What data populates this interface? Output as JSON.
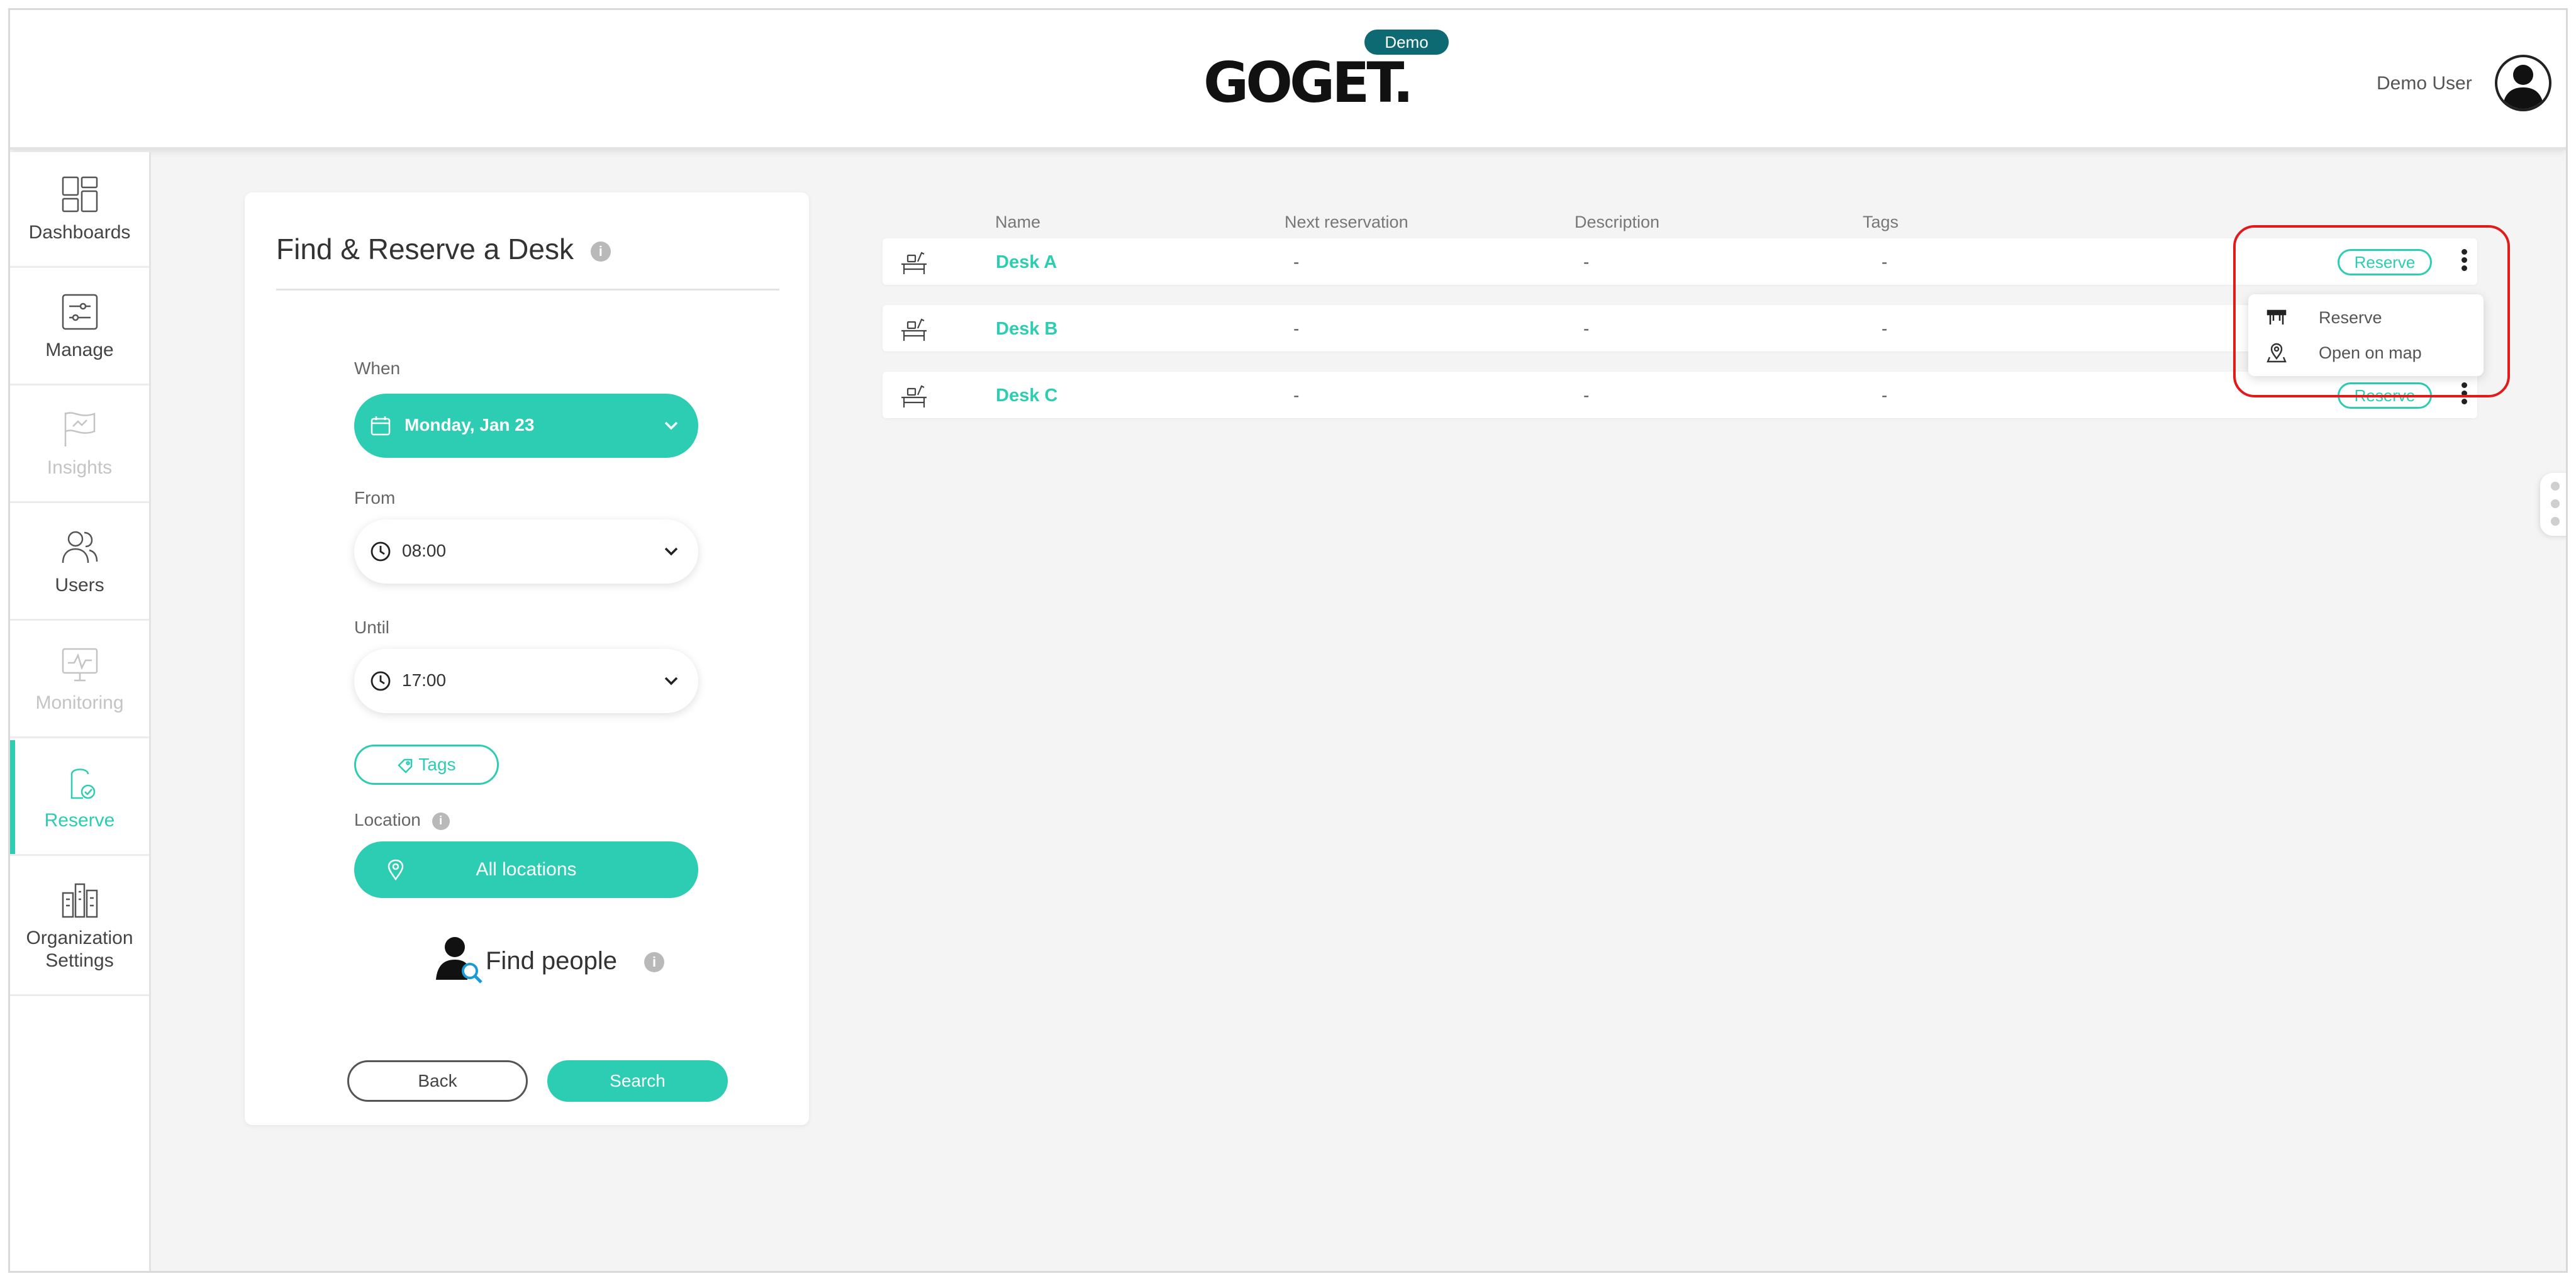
{
  "header": {
    "logo_text": "GOGET.",
    "badge": "Demo",
    "user_name": "Demo User"
  },
  "sidebar": {
    "items": [
      {
        "label": "Dashboards",
        "icon": "dashboard-icon",
        "state": "normal"
      },
      {
        "label": "Manage",
        "icon": "sliders-icon",
        "state": "normal"
      },
      {
        "label": "Insights",
        "icon": "flag-icon",
        "state": "disabled"
      },
      {
        "label": "Users",
        "icon": "users-icon",
        "state": "normal"
      },
      {
        "label": "Monitoring",
        "icon": "monitor-icon",
        "state": "disabled"
      },
      {
        "label": "Reserve",
        "icon": "lock-check-icon",
        "state": "active"
      },
      {
        "label": "Organization Settings",
        "icon": "buildings-icon",
        "state": "normal"
      }
    ]
  },
  "find_panel": {
    "title": "Find & Reserve a Desk",
    "info": "i",
    "when_label": "When",
    "date_value": "Monday, Jan 23",
    "from_label": "From",
    "from_value": "08:00",
    "until_label": "Until",
    "until_value": "17:00",
    "tags_label": "Tags",
    "location_label": "Location",
    "location_value": "All locations",
    "find_people_label": "Find people",
    "back_label": "Back",
    "search_label": "Search"
  },
  "table": {
    "columns": [
      "Name",
      "Next reservation",
      "Description",
      "Tags"
    ],
    "rows": [
      {
        "name": "Desk A",
        "next_reservation": "-",
        "description": "-",
        "tags": "-",
        "action": "Reserve"
      },
      {
        "name": "Desk B",
        "next_reservation": "-",
        "description": "-",
        "tags": "-",
        "action": ""
      },
      {
        "name": "Desk C",
        "next_reservation": "-",
        "description": "-",
        "tags": "-",
        "action": "Reserve"
      }
    ]
  },
  "dropdown": {
    "items": [
      {
        "label": "Reserve",
        "icon": "desk-icon"
      },
      {
        "label": "Open on map",
        "icon": "map-pin-icon"
      }
    ]
  },
  "colors": {
    "accent": "#2ccdb2",
    "badge": "#0e6a72",
    "highlight": "#e21a1a"
  }
}
